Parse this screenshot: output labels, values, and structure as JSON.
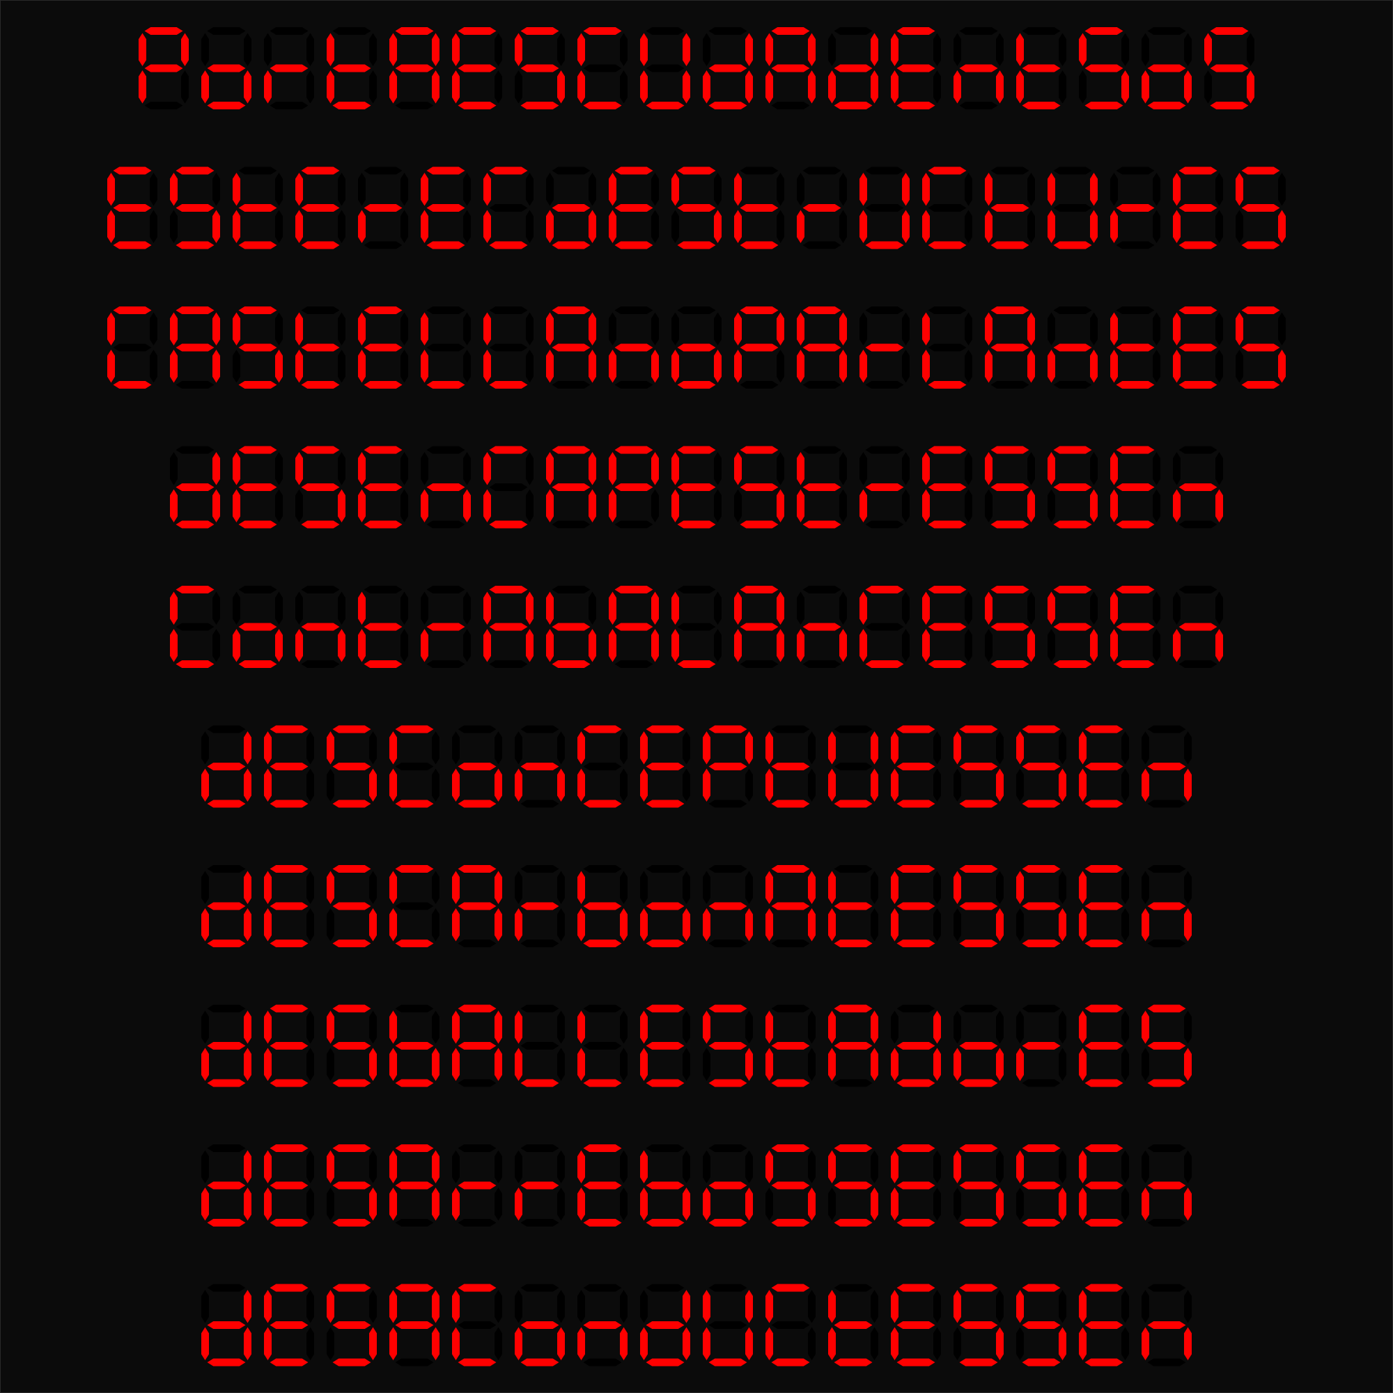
{
  "display": {
    "background_color": "#0b0b0b",
    "on_color": "#ff0000",
    "off_color": "#000000",
    "rows": [
      {
        "text": "PORTAESCUDADENTSOS"
      },
      {
        "text": "ESTERECOESTRUCTURES"
      },
      {
        "text": "CASTELLANOPARLANTES"
      },
      {
        "text": "DESENCAPESTRESSEN"
      },
      {
        "text": "CONTRABALANCESSEN"
      },
      {
        "text": "DESCONCEPTUESSEN"
      },
      {
        "text": "DESCARBONATESSEN"
      },
      {
        "text": "DESBALLESTADORES"
      },
      {
        "text": "DESARREBOSSESSEN"
      },
      {
        "text": "DESACONDUCTESSEN"
      }
    ]
  }
}
